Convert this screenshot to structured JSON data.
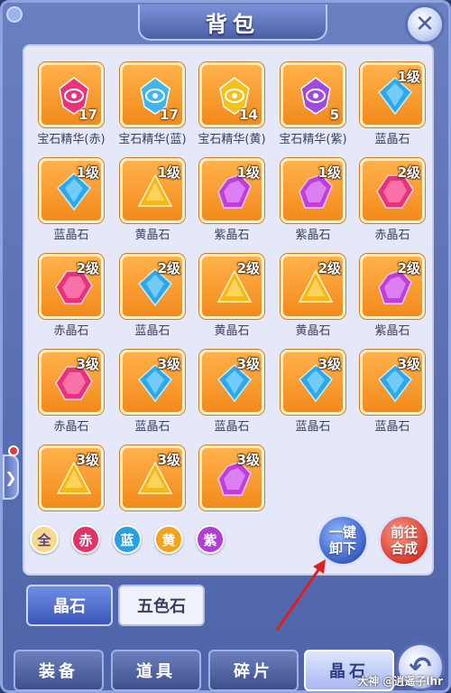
{
  "window": {
    "title": "背包",
    "close_glyph": "✕"
  },
  "items": [
    {
      "name": "宝石精华(赤)",
      "qty": "17",
      "level": "",
      "color": "#e8357a",
      "kind": "essence"
    },
    {
      "name": "宝石精华(蓝)",
      "qty": "17",
      "level": "",
      "color": "#3fb6ef",
      "kind": "essence"
    },
    {
      "name": "宝石精华(黄)",
      "qty": "14",
      "level": "",
      "color": "#f2c21a",
      "kind": "essence"
    },
    {
      "name": "宝石精华(紫)",
      "qty": "5",
      "level": "",
      "color": "#a04ae0",
      "kind": "essence"
    },
    {
      "name": "蓝晶石",
      "qty": "",
      "level": "1级",
      "color": "#2fa8ea",
      "kind": "blue"
    },
    {
      "name": "蓝晶石",
      "qty": "",
      "level": "1级",
      "color": "#2fa8ea",
      "kind": "blue"
    },
    {
      "name": "黄晶石",
      "qty": "",
      "level": "1级",
      "color": "#f4b81a",
      "kind": "yellow"
    },
    {
      "name": "紫晶石",
      "qty": "",
      "level": "1级",
      "color": "#c13fd8",
      "kind": "purple"
    },
    {
      "name": "紫晶石",
      "qty": "",
      "level": "1级",
      "color": "#c13fd8",
      "kind": "purple"
    },
    {
      "name": "赤晶石",
      "qty": "",
      "level": "2级",
      "color": "#e8337a",
      "kind": "red"
    },
    {
      "name": "赤晶石",
      "qty": "",
      "level": "2级",
      "color": "#e8337a",
      "kind": "red"
    },
    {
      "name": "蓝晶石",
      "qty": "",
      "level": "2级",
      "color": "#2fa8ea",
      "kind": "blue"
    },
    {
      "name": "黄晶石",
      "qty": "",
      "level": "2级",
      "color": "#f4b81a",
      "kind": "yellow"
    },
    {
      "name": "黄晶石",
      "qty": "",
      "level": "2级",
      "color": "#f4b81a",
      "kind": "yellow"
    },
    {
      "name": "紫晶石",
      "qty": "",
      "level": "2级",
      "color": "#c13fd8",
      "kind": "purple"
    },
    {
      "name": "赤晶石",
      "qty": "",
      "level": "3级",
      "color": "#e8337a",
      "kind": "red"
    },
    {
      "name": "蓝晶石",
      "qty": "",
      "level": "3级",
      "color": "#2fa8ea",
      "kind": "blue"
    },
    {
      "name": "蓝晶石",
      "qty": "",
      "level": "3级",
      "color": "#2fa8ea",
      "kind": "blue"
    },
    {
      "name": "蓝晶石",
      "qty": "",
      "level": "3级",
      "color": "#2fa8ea",
      "kind": "blue"
    },
    {
      "name": "蓝晶石",
      "qty": "",
      "level": "3级",
      "color": "#2fa8ea",
      "kind": "blue"
    },
    {
      "name": "",
      "qty": "",
      "level": "3级",
      "color": "#f4b81a",
      "kind": "yellow"
    },
    {
      "name": "",
      "qty": "",
      "level": "3级",
      "color": "#f4b81a",
      "kind": "yellow"
    },
    {
      "name": "",
      "qty": "",
      "level": "3级",
      "color": "#c13fd8",
      "kind": "purple"
    }
  ],
  "filters": [
    {
      "label": "全",
      "color": "#f6d98a",
      "text_color": "#5a3d8a"
    },
    {
      "label": "赤",
      "color": "#e2336c",
      "text_color": "#ffffff"
    },
    {
      "label": "蓝",
      "color": "#2b9fe0",
      "text_color": "#ffffff"
    },
    {
      "label": "黄",
      "color": "#f0a41a",
      "text_color": "#ffffff"
    },
    {
      "label": "紫",
      "color": "#b13fd6",
      "text_color": "#ffffff"
    }
  ],
  "actions": {
    "unequip_label_1": "一键",
    "unequip_label_2": "卸下",
    "synth_label_1": "前往",
    "synth_label_2": "合成"
  },
  "subtabs": [
    {
      "label": "晶石",
      "active": true
    },
    {
      "label": "五色石",
      "active": false
    }
  ],
  "bottom_tabs": [
    {
      "label": "装备",
      "active": false
    },
    {
      "label": "道具",
      "active": false
    },
    {
      "label": "碎片",
      "active": false
    },
    {
      "label": "晶石",
      "active": true
    }
  ],
  "back_glyph": "↶",
  "side_arrow_glyph": "❯",
  "watermark": "大神 @逍遥子lhr"
}
